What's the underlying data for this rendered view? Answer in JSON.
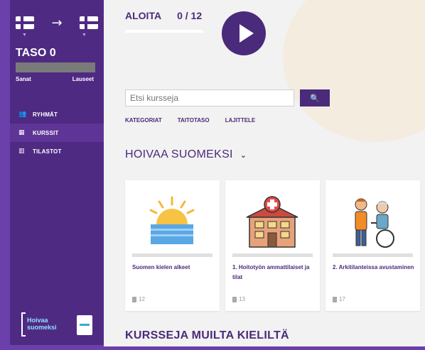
{
  "sidebar": {
    "level": "TASO 0",
    "level_progress": 0,
    "left_label": "Sanat",
    "right_label": "Lauseet",
    "nav": [
      {
        "label": "RYHMÄT",
        "icon": "group-icon"
      },
      {
        "label": "KURSSIT",
        "icon": "courses-icon"
      },
      {
        "label": "TILASTOT",
        "icon": "stats-icon"
      }
    ],
    "logo_line1": "Hoivaa",
    "logo_line2": "suomeksi"
  },
  "header": {
    "start_label": "ALOITA",
    "progress": "0 / 12"
  },
  "search": {
    "placeholder": "Etsi kursseja",
    "button_icon": "search-icon"
  },
  "filters": [
    "KATEGORIAT",
    "TAITOTASO",
    "LAJITTELE"
  ],
  "section": {
    "title": "HOIVAA SUOMEKSI"
  },
  "courses": [
    {
      "title": "Suomen kielen alkeet",
      "count": "12",
      "icon": "sunrise-icon"
    },
    {
      "title": "1. Hoitotyön ammattilaiset ja tilat",
      "count": "13",
      "icon": "hospital-icon"
    },
    {
      "title": "2. Arkitilanteissa avustaminen",
      "count": "17",
      "icon": "caregiver-wheelchair-icon"
    }
  ],
  "other_section_title": "KURSSEJA MUILTA KIELILTÄ",
  "colors": {
    "primary": "#4a2a7a",
    "sidebar": "#4f2a83",
    "frame": "#6b40aa"
  }
}
